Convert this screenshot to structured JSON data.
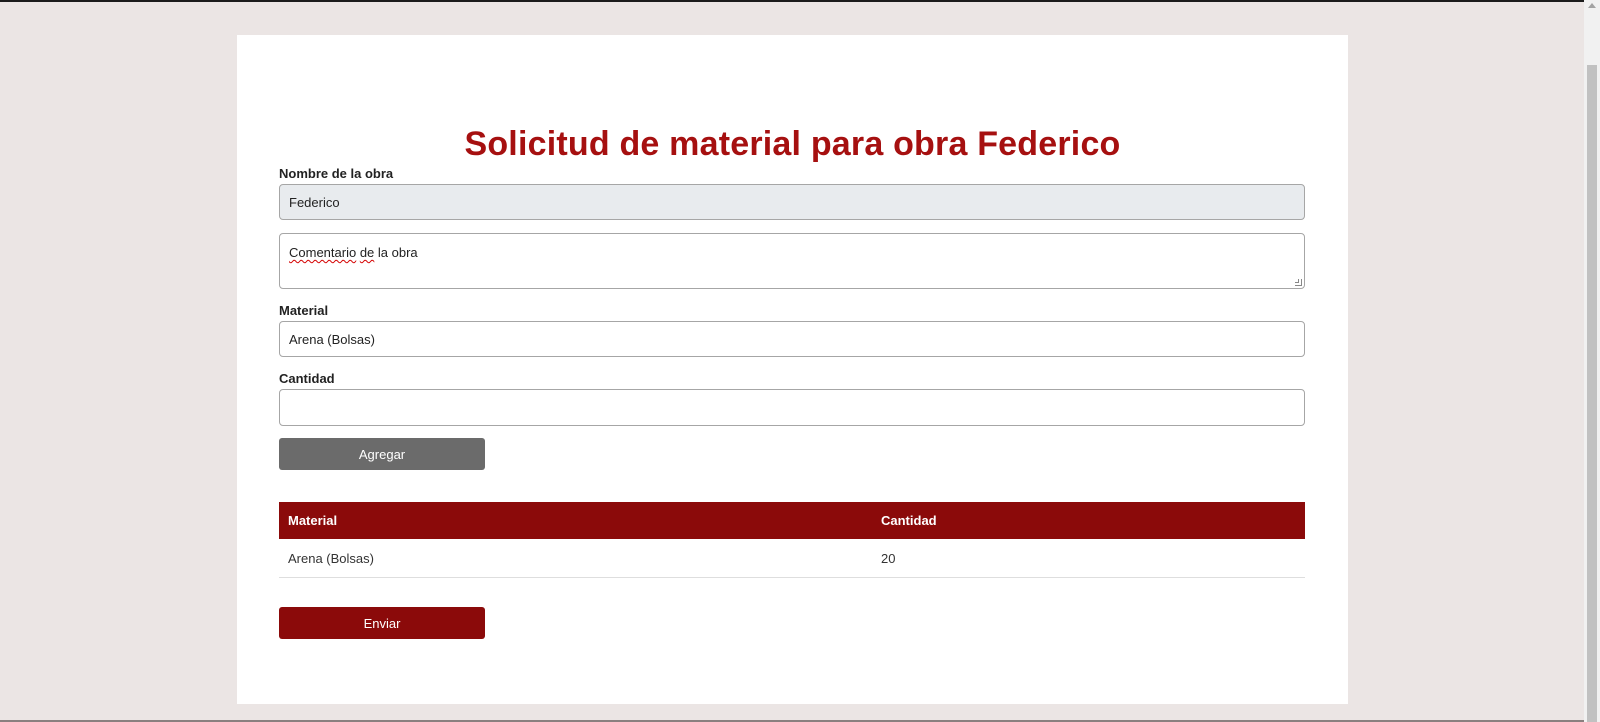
{
  "page": {
    "title": "Solicitud de material para obra Federico"
  },
  "form": {
    "obra_label": "Nombre de la obra",
    "obra_value": "Federico",
    "comment_value_word1": "Comentario",
    "comment_value_word2": "de",
    "comment_value_rest": " la obra",
    "material_label": "Material",
    "material_value": "Arena (Bolsas)",
    "cantidad_label": "Cantidad",
    "cantidad_value": "",
    "add_button_label": "Agregar",
    "submit_button_label": "Enviar"
  },
  "table": {
    "columns": [
      "Material",
      "Cantidad"
    ],
    "rows": [
      [
        "Arena (Bolsas)",
        "20"
      ]
    ]
  },
  "colors": {
    "accent": "#8b0a0a",
    "title": "#a61010",
    "background": "#ebe5e4",
    "secondary_button": "#6b6b6b"
  }
}
